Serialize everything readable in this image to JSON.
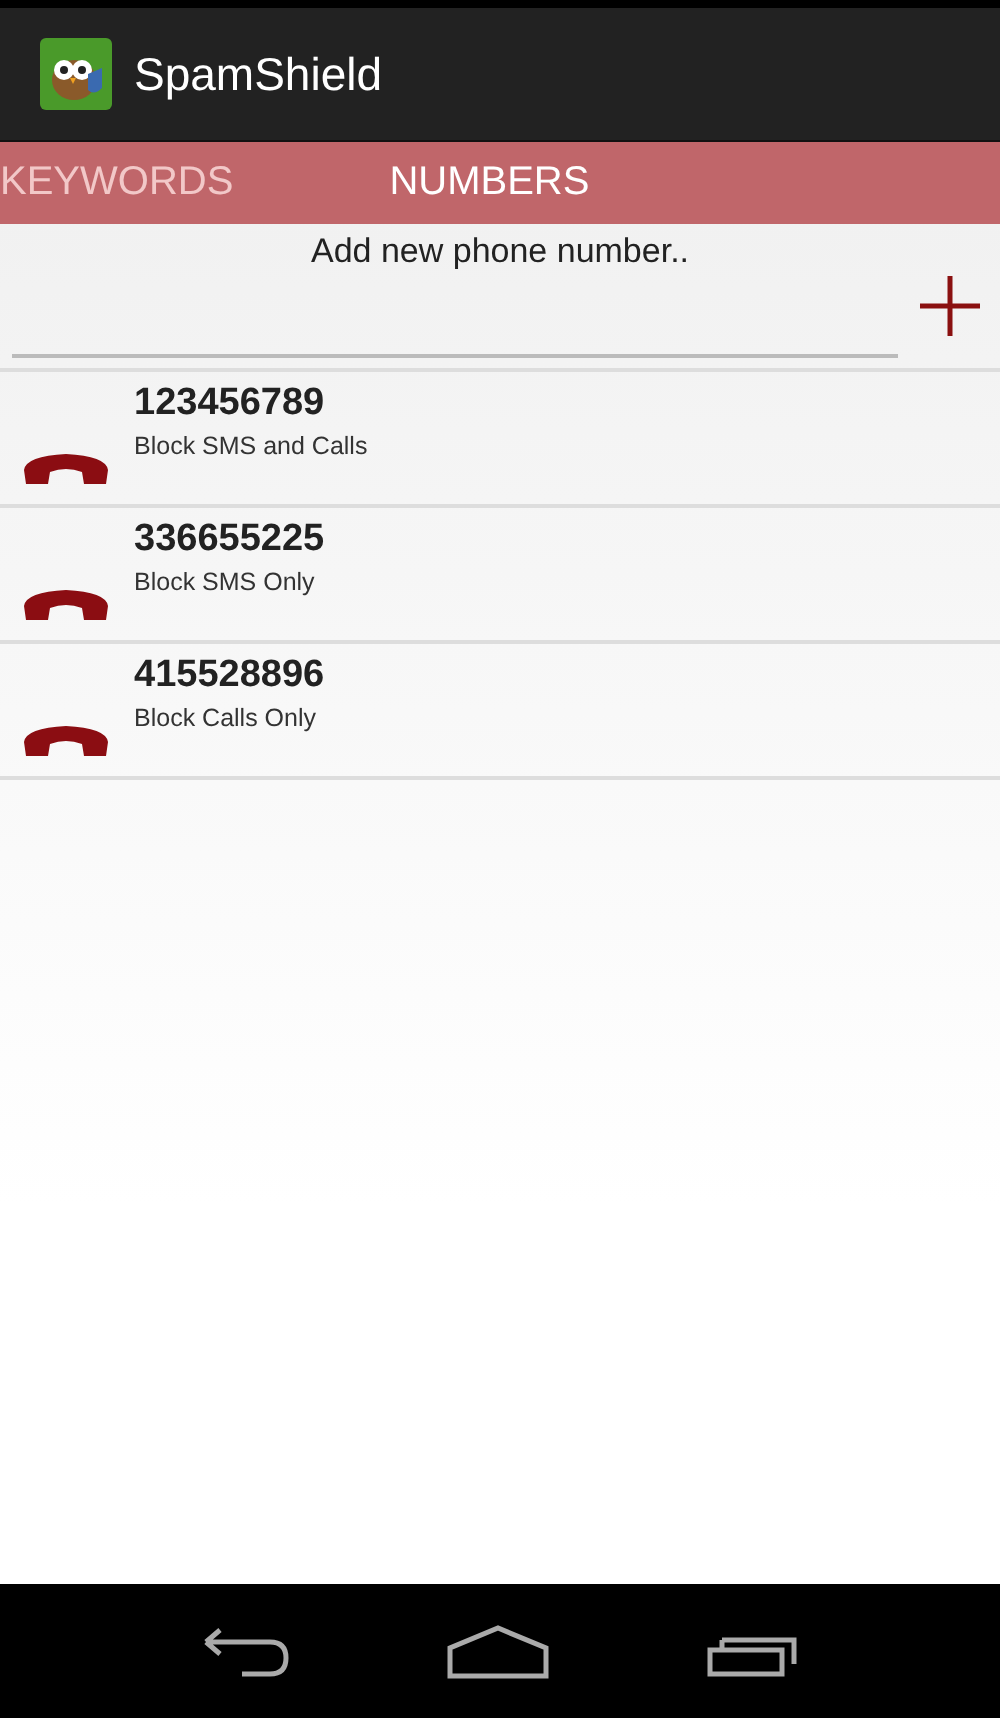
{
  "app_bar": {
    "title": "SpamShield"
  },
  "tabs": [
    {
      "label": "KEYWORDS",
      "selected": false
    },
    {
      "label": "NUMBERS",
      "selected": true
    }
  ],
  "add_number": {
    "label": "Add new phone number.."
  },
  "numbers": [
    {
      "number": "123456789",
      "mode": "Block SMS and Calls"
    },
    {
      "number": "336655225",
      "mode": "Block SMS Only"
    },
    {
      "number": "415528896",
      "mode": "Block Calls Only"
    }
  ]
}
